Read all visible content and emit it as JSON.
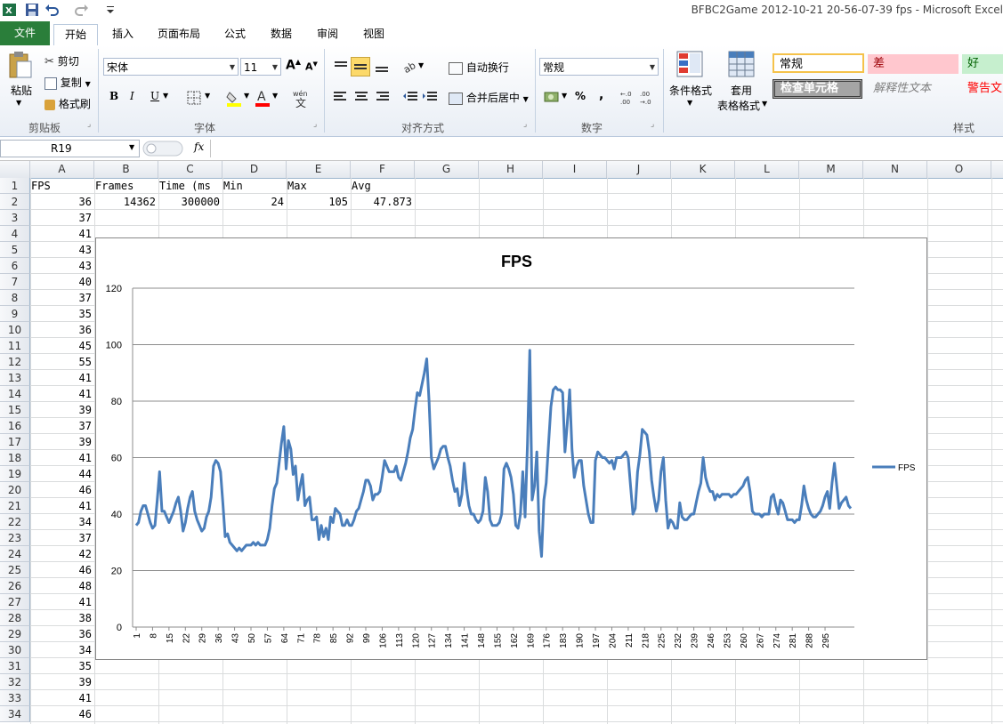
{
  "window": {
    "title": "BFBC2Game 2012-10-21 20-56-07-39 fps  -  Microsoft Excel"
  },
  "tabs": [
    "文件",
    "开始",
    "插入",
    "页面布局",
    "公式",
    "数据",
    "审阅",
    "视图"
  ],
  "ribbon": {
    "clipboard": {
      "paste": "粘贴",
      "cut": "剪切",
      "copy": "复制",
      "format_painter": "格式刷",
      "label": "剪贴板"
    },
    "font": {
      "name": "宋体",
      "size": "11",
      "label": "字体",
      "bold": "B",
      "italic": "I",
      "underline": "U",
      "grow": "A",
      "shrink": "A"
    },
    "alignment": {
      "wrap": "自动换行",
      "merge": "合并后居中",
      "label": "对齐方式"
    },
    "number": {
      "format": "常规",
      "percent": "%",
      "comma": ",",
      "label": "数字"
    },
    "styles": {
      "conditional": "条件格式",
      "table_format_1": "套用",
      "table_format_2": "表格格式",
      "label": "样式",
      "normal": "常规",
      "bad": "差",
      "good": "好",
      "check_cell": "检查单元格",
      "explanatory": "解释性文本",
      "warning": "警告文"
    }
  },
  "formula_bar": {
    "name_box": "R19",
    "fx": "fx",
    "formula": ""
  },
  "columns": [
    "A",
    "B",
    "C",
    "D",
    "E",
    "F",
    "G",
    "H",
    "I",
    "J",
    "K",
    "L",
    "M",
    "N",
    "O"
  ],
  "rows": [
    "1",
    "2",
    "3",
    "4",
    "5",
    "6",
    "7",
    "8",
    "9",
    "10",
    "11",
    "12",
    "13",
    "14",
    "15",
    "16",
    "17",
    "18",
    "19",
    "20",
    "21",
    "22",
    "23",
    "24",
    "25",
    "26",
    "27",
    "28",
    "29",
    "30",
    "31",
    "32",
    "33",
    "34"
  ],
  "header_row": [
    "FPS",
    "Frames",
    "Time (ms",
    "Min",
    "Max",
    "Avg"
  ],
  "row2": [
    "36",
    "14362",
    "300000",
    "24",
    "105",
    "47.873"
  ],
  "colA": [
    "37",
    "41",
    "43",
    "43",
    "40",
    "37",
    "35",
    "36",
    "45",
    "55",
    "41",
    "41",
    "39",
    "37",
    "39",
    "41",
    "44",
    "46",
    "41",
    "34",
    "37",
    "42",
    "46",
    "48",
    "41",
    "38",
    "36",
    "34",
    "35",
    "39",
    "41",
    "46"
  ],
  "chart_data": {
    "type": "line",
    "title": "FPS",
    "xlabel": "",
    "ylabel": "",
    "ylim": [
      0,
      120
    ],
    "yticks": [
      0,
      20,
      40,
      60,
      80,
      100,
      120
    ],
    "grid": true,
    "legend": "right",
    "color": "#4a7ebb",
    "xtick_labels": [
      "1",
      "8",
      "15",
      "22",
      "29",
      "36",
      "43",
      "50",
      "57",
      "64",
      "71",
      "78",
      "85",
      "92",
      "99",
      "106",
      "113",
      "120",
      "127",
      "134",
      "141",
      "148",
      "155",
      "162",
      "169",
      "176",
      "183",
      "190",
      "197",
      "204",
      "211",
      "218",
      "225",
      "232",
      "239",
      "246",
      "253",
      "260",
      "267",
      "274",
      "281",
      "288",
      "295"
    ],
    "series": [
      {
        "name": "FPS",
        "values": [
          36,
          37,
          41,
          43,
          43,
          40,
          37,
          35,
          36,
          45,
          55,
          41,
          41,
          39,
          37,
          39,
          41,
          44,
          46,
          41,
          34,
          37,
          42,
          46,
          48,
          41,
          38,
          36,
          34,
          35,
          39,
          41,
          46,
          57,
          59,
          58,
          55,
          44,
          32,
          33,
          30,
          29,
          28,
          27,
          28,
          27,
          28,
          29,
          29,
          29,
          30,
          29,
          30,
          29,
          29,
          29,
          31,
          35,
          43,
          49,
          51,
          58,
          65,
          71,
          56,
          66,
          63,
          54,
          57,
          45,
          50,
          54,
          43,
          45,
          46,
          38,
          38,
          39,
          31,
          36,
          32,
          35,
          31,
          39,
          37,
          42,
          41,
          40,
          36,
          36,
          38,
          36,
          36,
          38,
          41,
          42,
          45,
          48,
          52,
          52,
          50,
          45,
          47,
          47,
          48,
          53,
          59,
          57,
          55,
          55,
          55,
          57,
          53,
          52,
          55,
          58,
          62,
          67,
          70,
          77,
          83,
          82,
          86,
          90,
          95,
          80,
          60,
          56,
          58,
          60,
          63,
          64,
          64,
          60,
          57,
          52,
          48,
          49,
          43,
          47,
          58,
          49,
          43,
          40,
          40,
          38,
          37,
          38,
          41,
          53,
          48,
          38,
          36,
          36,
          36,
          37,
          40,
          56,
          58,
          56,
          53,
          47,
          36,
          35,
          40,
          55,
          39,
          65,
          98,
          45,
          50,
          62,
          34,
          25,
          45,
          51,
          65,
          78,
          84,
          85,
          84,
          84,
          83,
          62,
          72,
          84,
          63,
          53,
          57,
          59,
          59,
          50,
          45,
          40,
          37,
          37,
          59,
          62,
          61,
          60,
          60,
          59,
          58,
          59,
          56,
          60,
          60,
          60,
          61,
          62,
          60,
          50,
          40,
          42,
          55,
          61,
          70,
          69,
          68,
          62,
          52,
          46,
          41,
          45,
          55,
          60,
          45,
          35,
          38,
          37,
          35,
          35,
          44,
          39,
          38,
          38,
          39,
          40,
          40,
          44,
          48,
          51,
          60,
          53,
          50,
          48,
          48,
          45,
          47,
          46,
          47,
          47,
          47,
          47,
          46,
          47,
          47,
          48,
          49,
          50,
          52,
          53,
          48,
          41,
          40,
          40,
          40,
          39,
          40,
          40,
          40,
          46,
          47,
          43,
          40,
          45,
          44,
          41,
          38,
          38,
          38,
          37,
          38,
          38,
          43,
          50,
          45,
          42,
          40,
          39,
          39,
          40,
          41,
          43,
          46,
          48,
          42,
          51,
          58,
          50,
          42,
          44,
          45,
          46,
          43,
          42
        ]
      }
    ]
  }
}
